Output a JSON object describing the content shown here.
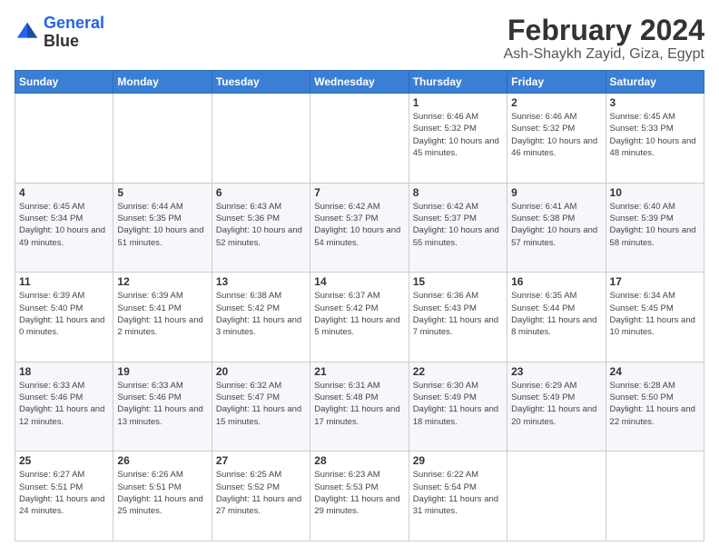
{
  "logo": {
    "line1": "General",
    "line2": "Blue"
  },
  "header": {
    "title": "February 2024",
    "subtitle": "Ash-Shaykh Zayid, Giza, Egypt"
  },
  "weekdays": [
    "Sunday",
    "Monday",
    "Tuesday",
    "Wednesday",
    "Thursday",
    "Friday",
    "Saturday"
  ],
  "weeks": [
    [
      {
        "day": "",
        "info": ""
      },
      {
        "day": "",
        "info": ""
      },
      {
        "day": "",
        "info": ""
      },
      {
        "day": "",
        "info": ""
      },
      {
        "day": "1",
        "info": "Sunrise: 6:46 AM\nSunset: 5:32 PM\nDaylight: 10 hours\nand 45 minutes."
      },
      {
        "day": "2",
        "info": "Sunrise: 6:46 AM\nSunset: 5:32 PM\nDaylight: 10 hours\nand 46 minutes."
      },
      {
        "day": "3",
        "info": "Sunrise: 6:45 AM\nSunset: 5:33 PM\nDaylight: 10 hours\nand 48 minutes."
      }
    ],
    [
      {
        "day": "4",
        "info": "Sunrise: 6:45 AM\nSunset: 5:34 PM\nDaylight: 10 hours\nand 49 minutes."
      },
      {
        "day": "5",
        "info": "Sunrise: 6:44 AM\nSunset: 5:35 PM\nDaylight: 10 hours\nand 51 minutes."
      },
      {
        "day": "6",
        "info": "Sunrise: 6:43 AM\nSunset: 5:36 PM\nDaylight: 10 hours\nand 52 minutes."
      },
      {
        "day": "7",
        "info": "Sunrise: 6:42 AM\nSunset: 5:37 PM\nDaylight: 10 hours\nand 54 minutes."
      },
      {
        "day": "8",
        "info": "Sunrise: 6:42 AM\nSunset: 5:37 PM\nDaylight: 10 hours\nand 55 minutes."
      },
      {
        "day": "9",
        "info": "Sunrise: 6:41 AM\nSunset: 5:38 PM\nDaylight: 10 hours\nand 57 minutes."
      },
      {
        "day": "10",
        "info": "Sunrise: 6:40 AM\nSunset: 5:39 PM\nDaylight: 10 hours\nand 58 minutes."
      }
    ],
    [
      {
        "day": "11",
        "info": "Sunrise: 6:39 AM\nSunset: 5:40 PM\nDaylight: 11 hours\nand 0 minutes."
      },
      {
        "day": "12",
        "info": "Sunrise: 6:39 AM\nSunset: 5:41 PM\nDaylight: 11 hours\nand 2 minutes."
      },
      {
        "day": "13",
        "info": "Sunrise: 6:38 AM\nSunset: 5:42 PM\nDaylight: 11 hours\nand 3 minutes."
      },
      {
        "day": "14",
        "info": "Sunrise: 6:37 AM\nSunset: 5:42 PM\nDaylight: 11 hours\nand 5 minutes."
      },
      {
        "day": "15",
        "info": "Sunrise: 6:36 AM\nSunset: 5:43 PM\nDaylight: 11 hours\nand 7 minutes."
      },
      {
        "day": "16",
        "info": "Sunrise: 6:35 AM\nSunset: 5:44 PM\nDaylight: 11 hours\nand 8 minutes."
      },
      {
        "day": "17",
        "info": "Sunrise: 6:34 AM\nSunset: 5:45 PM\nDaylight: 11 hours\nand 10 minutes."
      }
    ],
    [
      {
        "day": "18",
        "info": "Sunrise: 6:33 AM\nSunset: 5:46 PM\nDaylight: 11 hours\nand 12 minutes."
      },
      {
        "day": "19",
        "info": "Sunrise: 6:33 AM\nSunset: 5:46 PM\nDaylight: 11 hours\nand 13 minutes."
      },
      {
        "day": "20",
        "info": "Sunrise: 6:32 AM\nSunset: 5:47 PM\nDaylight: 11 hours\nand 15 minutes."
      },
      {
        "day": "21",
        "info": "Sunrise: 6:31 AM\nSunset: 5:48 PM\nDaylight: 11 hours\nand 17 minutes."
      },
      {
        "day": "22",
        "info": "Sunrise: 6:30 AM\nSunset: 5:49 PM\nDaylight: 11 hours\nand 18 minutes."
      },
      {
        "day": "23",
        "info": "Sunrise: 6:29 AM\nSunset: 5:49 PM\nDaylight: 11 hours\nand 20 minutes."
      },
      {
        "day": "24",
        "info": "Sunrise: 6:28 AM\nSunset: 5:50 PM\nDaylight: 11 hours\nand 22 minutes."
      }
    ],
    [
      {
        "day": "25",
        "info": "Sunrise: 6:27 AM\nSunset: 5:51 PM\nDaylight: 11 hours\nand 24 minutes."
      },
      {
        "day": "26",
        "info": "Sunrise: 6:26 AM\nSunset: 5:51 PM\nDaylight: 11 hours\nand 25 minutes."
      },
      {
        "day": "27",
        "info": "Sunrise: 6:25 AM\nSunset: 5:52 PM\nDaylight: 11 hours\nand 27 minutes."
      },
      {
        "day": "28",
        "info": "Sunrise: 6:23 AM\nSunset: 5:53 PM\nDaylight: 11 hours\nand 29 minutes."
      },
      {
        "day": "29",
        "info": "Sunrise: 6:22 AM\nSunset: 5:54 PM\nDaylight: 11 hours\nand 31 minutes."
      },
      {
        "day": "",
        "info": ""
      },
      {
        "day": "",
        "info": ""
      }
    ]
  ]
}
